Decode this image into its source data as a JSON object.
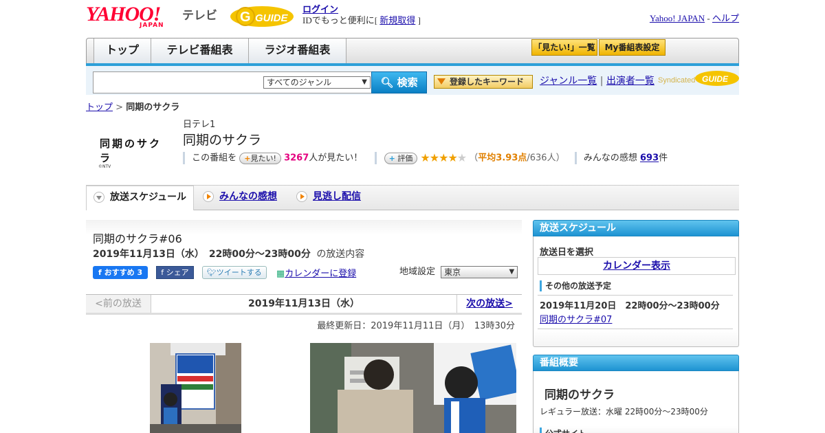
{
  "header": {
    "yahoo_logo": "YAHOO!",
    "yahoo_sub": "JAPAN",
    "service": "テレビ",
    "gguide_logo": "GUIDE",
    "login": "ログイン",
    "login_prompt_pre": "IDでもっと便利に[",
    "register": "新規取得",
    "login_prompt_post": "]",
    "yahoo_japan_link": "Yahoo! JAPAN",
    "separator": "-",
    "help_link": "ヘルプ"
  },
  "nav": {
    "tabs": [
      {
        "label": "トップ"
      },
      {
        "label": "テレビ番組表"
      },
      {
        "label": "ラジオ番組表"
      }
    ],
    "mitai_list": "「見たい!」一覧",
    "my_schedule": "My番組表設定"
  },
  "search": {
    "input_value": "",
    "genre_selected": "すべてのジャンル",
    "search_button": "検索",
    "keyword_button": "登録したキーワード",
    "genre_list": "ジャンル一覧",
    "link_separator": "|",
    "performer_list": "出演者一覧",
    "syndicated": "Syndicated"
  },
  "breadcrumb": {
    "top": "トップ",
    "separator": ">",
    "current": "同期のサクラ"
  },
  "program": {
    "thumb_title": "同期のサクラ",
    "thumb_copyright": "©NTV",
    "channel": "日テレ1",
    "title": "同期のサクラ",
    "want_prefix": "この番組を",
    "want_button": "見たい!",
    "want_count": "3267",
    "want_suffix": "人が見たい！",
    "rate_button": "評価",
    "rating_value": 3.93,
    "rating_prefix": "（",
    "rating_avg": "平均3.93点",
    "rating_count": "/636人）",
    "impressions_label": "みんなの感想",
    "impressions_count": "693",
    "impressions_unit": "件"
  },
  "tabs": [
    {
      "label": "放送スケジュール"
    },
    {
      "label": "みんなの感想"
    },
    {
      "label": "見逃し配信"
    }
  ],
  "episode": {
    "title": "同期のサクラ#06",
    "date": "2019年11月13日（水）　22時00分～23時00分",
    "date_suffix": "の放送内容",
    "fb_button": "おすすめ 3",
    "share_button": "シェア",
    "tweet_button": "ツイートする",
    "calendar_link": "カレンダーに登録",
    "region_label": "地域設定",
    "region_value": "東京",
    "prev": "<前の放送",
    "current": "2019年11月13日（水）",
    "next": "次の放送>",
    "updated": "最終更新日：2019年11月11日（月）　13時30分"
  },
  "sidebar": {
    "schedule_header": "放送スケジュール",
    "select_date": "放送日を選択",
    "calendar_button": "カレンダー表示",
    "other_header": "その他の放送予定",
    "other_date": "2019年11月20日　22時00分～23時00分",
    "other_link": "同期のサクラ#07",
    "summary_header": "番組概要",
    "summary_title": "同期のサクラ",
    "regular": "レギュラー放送：水曜 22時00分～23時00分",
    "official_site": "公式サイト"
  },
  "colors": {
    "accent_blue": "#2c9fd8",
    "yahoo_red": "#ff0033",
    "want_pink": "#e4007f",
    "rating_orange": "#e08000",
    "star_gold": "#f0a000"
  }
}
